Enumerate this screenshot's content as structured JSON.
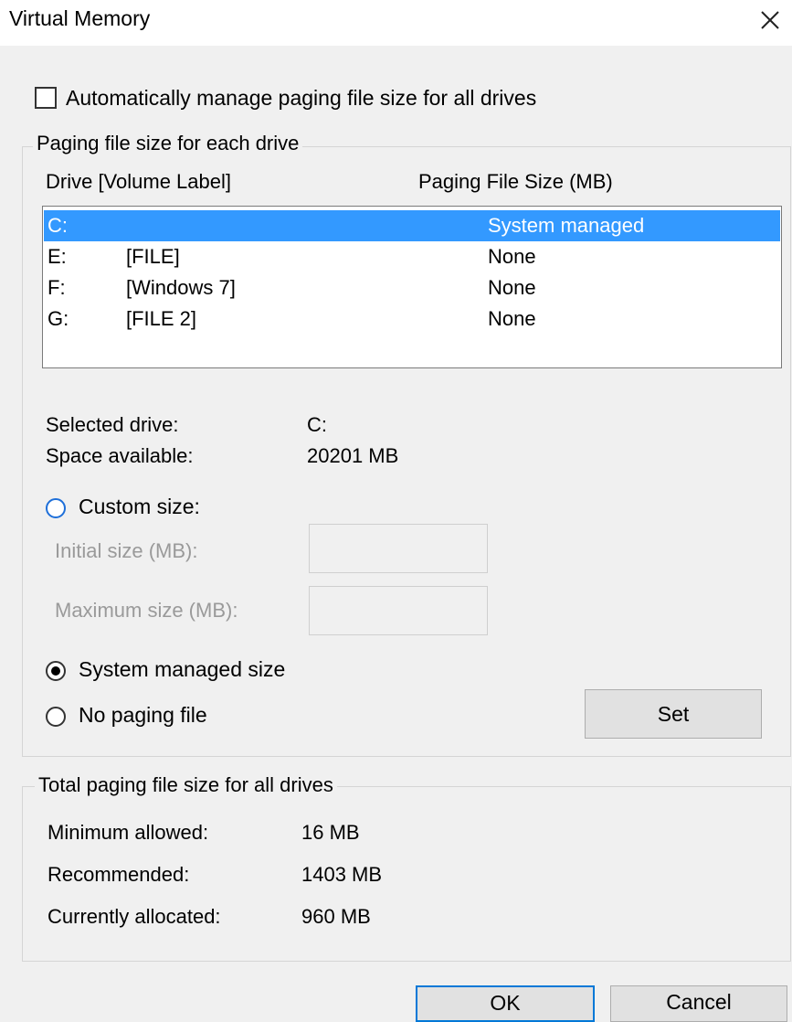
{
  "window": {
    "title": "Virtual Memory",
    "close_icon": "close-icon"
  },
  "auto_manage": {
    "label": "Automatically manage paging file size for all drives",
    "checked": false
  },
  "paging_group": {
    "title": "Paging file size for each drive",
    "col_drive": "Drive  [Volume Label]",
    "col_size": "Paging File Size (MB)",
    "drives": [
      {
        "letter": "C:",
        "label": "",
        "size": "System managed",
        "selected": true
      },
      {
        "letter": "E:",
        "label": "[FILE]",
        "size": "None",
        "selected": false
      },
      {
        "letter": "F:",
        "label": "[Windows 7]",
        "size": "None",
        "selected": false
      },
      {
        "letter": "G:",
        "label": "[FILE 2]",
        "size": "None",
        "selected": false
      }
    ],
    "selected_drive_label": "Selected drive:",
    "selected_drive_value": "C:",
    "space_available_label": "Space available:",
    "space_available_value": "20201 MB",
    "custom_size_label": "Custom size:",
    "initial_size_label": "Initial size (MB):",
    "initial_size_value": "",
    "maximum_size_label": "Maximum size (MB):",
    "maximum_size_value": "",
    "system_managed_label": "System managed size",
    "no_paging_label": "No paging file",
    "selected_option": "System managed size",
    "set_button": "Set"
  },
  "total_group": {
    "title": "Total paging file size for all drives",
    "minimum_label": "Minimum allowed:",
    "minimum_value": "16 MB",
    "recommended_label": "Recommended:",
    "recommended_value": "1403 MB",
    "allocated_label": "Currently allocated:",
    "allocated_value": "960 MB"
  },
  "footer": {
    "ok_button": "OK",
    "cancel_button": "Cancel"
  },
  "colors": {
    "selection": "#3399ff",
    "accent": "#0078d7"
  }
}
